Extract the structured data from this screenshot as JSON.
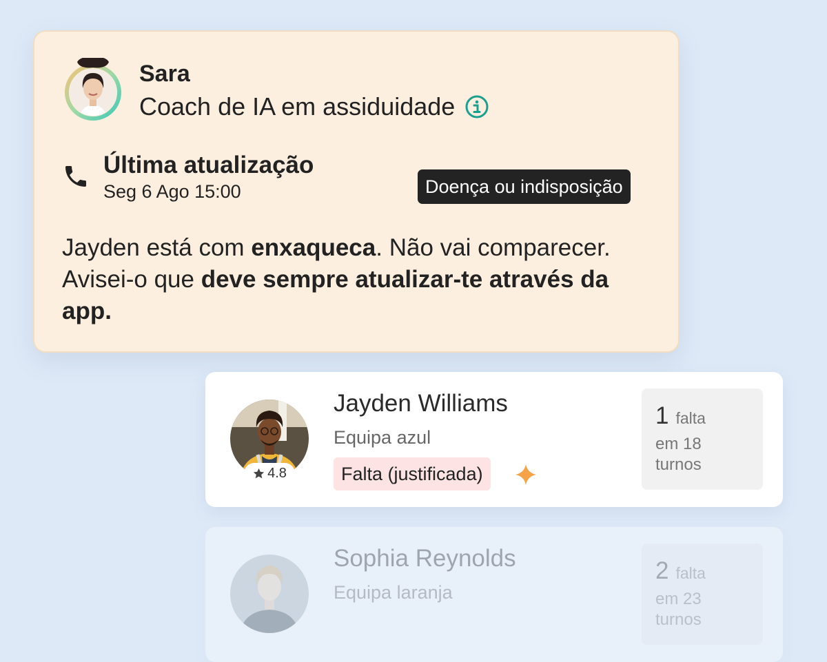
{
  "coach": {
    "name": "Sara",
    "role": "Coach de IA em assiduidade",
    "avatar": "coach-avatar",
    "info_icon": "info-icon"
  },
  "update": {
    "icon": "phone-icon",
    "title": "Última atualização",
    "time": "Seg 6 Ago 15:00",
    "reason_badge": "Doença ou indisposição"
  },
  "message": {
    "part1": "Jayden está com ",
    "bold1": "enxaqueca",
    "part2": ". Não vai comparecer. Avisei-o que ",
    "bold2": "deve sempre atualizar-te através da app."
  },
  "workers": [
    {
      "name": "Jayden Williams",
      "team": "Equipa azul",
      "rating": "4.8",
      "status": "Falta (justificada)",
      "absence_count": "1",
      "absence_unit": "falta",
      "absence_context": "em 18 turnos"
    },
    {
      "name": "Sophia Reynolds",
      "team": "Equipa laranja",
      "absence_count": "2",
      "absence_unit": "falta",
      "absence_context": "em 23 turnos"
    }
  ],
  "colors": {
    "background": "#dde9f7",
    "ai_card": "#fdefdf",
    "teal_accent": "#1aa08f",
    "status_badge": "#fde3e3",
    "sparkle": "#f6a347"
  }
}
